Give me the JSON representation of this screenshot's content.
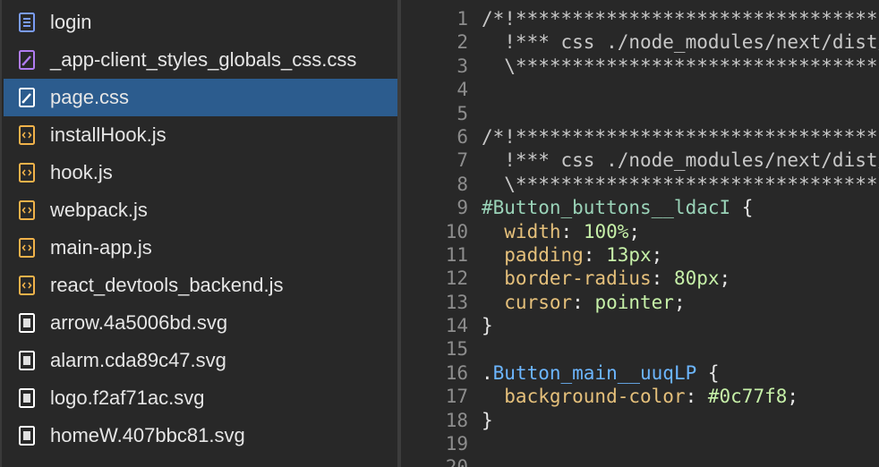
{
  "sidebar": {
    "files": [
      {
        "name": "login",
        "icon": "document-icon",
        "color": "#7a9cf5"
      },
      {
        "name": "_app-client_styles_globals_css.css",
        "icon": "stylesheet-icon",
        "color": "#b07cf2"
      },
      {
        "name": "page.css",
        "icon": "stylesheet-icon",
        "color": "#ffffff",
        "selected": true
      },
      {
        "name": "installHook.js",
        "icon": "script-icon",
        "color": "#f0b24a"
      },
      {
        "name": "hook.js",
        "icon": "script-icon",
        "color": "#f0b24a"
      },
      {
        "name": "webpack.js",
        "icon": "script-icon",
        "color": "#f0b24a"
      },
      {
        "name": "main-app.js",
        "icon": "script-icon",
        "color": "#f0b24a"
      },
      {
        "name": "react_devtools_backend.js",
        "icon": "script-icon",
        "color": "#f0b24a"
      },
      {
        "name": "arrow.4a5006bd.svg",
        "icon": "image-icon",
        "color": "#ffffff"
      },
      {
        "name": "alarm.cda89c47.svg",
        "icon": "image-icon",
        "color": "#ffffff"
      },
      {
        "name": "logo.f2af71ac.svg",
        "icon": "image-icon",
        "color": "#ffffff"
      },
      {
        "name": "homeW.407bbc81.svg",
        "icon": "image-icon",
        "color": "#ffffff"
      }
    ]
  },
  "editor": {
    "lines": [
      {
        "n": "1",
        "tokens": [
          {
            "t": "/*!******************************************",
            "c": "comment"
          }
        ]
      },
      {
        "n": "2",
        "tokens": [
          {
            "t": "  !*** css ./node_modules/next/dist/build",
            "c": "comment"
          }
        ]
      },
      {
        "n": "3",
        "tokens": [
          {
            "t": "  \\*****************************************",
            "c": "comment"
          }
        ]
      },
      {
        "n": "4",
        "tokens": []
      },
      {
        "n": "5",
        "tokens": []
      },
      {
        "n": "6",
        "tokens": [
          {
            "t": "/*!******************************************",
            "c": "comment"
          }
        ]
      },
      {
        "n": "7",
        "tokens": [
          {
            "t": "  !*** css ./node_modules/next/dist/build",
            "c": "comment"
          }
        ]
      },
      {
        "n": "8",
        "tokens": [
          {
            "t": "  \\*****************************************",
            "c": "comment"
          }
        ]
      },
      {
        "n": "9",
        "tokens": [
          {
            "t": "#Button_buttons__ldacI",
            "c": "selector"
          },
          {
            "t": " {",
            "c": "punc"
          }
        ]
      },
      {
        "n": "10",
        "tokens": [
          {
            "t": "  width",
            "c": "prop"
          },
          {
            "t": ": ",
            "c": "punc"
          },
          {
            "t": "100%",
            "c": "value"
          },
          {
            "t": ";",
            "c": "punc"
          }
        ]
      },
      {
        "n": "11",
        "tokens": [
          {
            "t": "  padding",
            "c": "prop"
          },
          {
            "t": ": ",
            "c": "punc"
          },
          {
            "t": "13px",
            "c": "value"
          },
          {
            "t": ";",
            "c": "punc"
          }
        ]
      },
      {
        "n": "12",
        "tokens": [
          {
            "t": "  border-radius",
            "c": "prop"
          },
          {
            "t": ": ",
            "c": "punc"
          },
          {
            "t": "80px",
            "c": "value"
          },
          {
            "t": ";",
            "c": "punc"
          }
        ]
      },
      {
        "n": "13",
        "tokens": [
          {
            "t": "  cursor",
            "c": "prop"
          },
          {
            "t": ": ",
            "c": "punc"
          },
          {
            "t": "pointer",
            "c": "value"
          },
          {
            "t": ";",
            "c": "punc"
          }
        ]
      },
      {
        "n": "14",
        "tokens": [
          {
            "t": "}",
            "c": "punc"
          }
        ]
      },
      {
        "n": "15",
        "tokens": []
      },
      {
        "n": "16",
        "tokens": [
          {
            "t": ".",
            "c": "punc"
          },
          {
            "t": "Button_main__uuqLP",
            "c": "class"
          },
          {
            "t": " {",
            "c": "punc"
          }
        ]
      },
      {
        "n": "17",
        "tokens": [
          {
            "t": "  background-color",
            "c": "prop"
          },
          {
            "t": ": ",
            "c": "punc"
          },
          {
            "t": "#0c77f8",
            "c": "value"
          },
          {
            "t": ";",
            "c": "punc"
          }
        ]
      },
      {
        "n": "18",
        "tokens": [
          {
            "t": "}",
            "c": "punc"
          }
        ]
      },
      {
        "n": "19",
        "tokens": []
      },
      {
        "n": "20",
        "tokens": []
      }
    ]
  }
}
